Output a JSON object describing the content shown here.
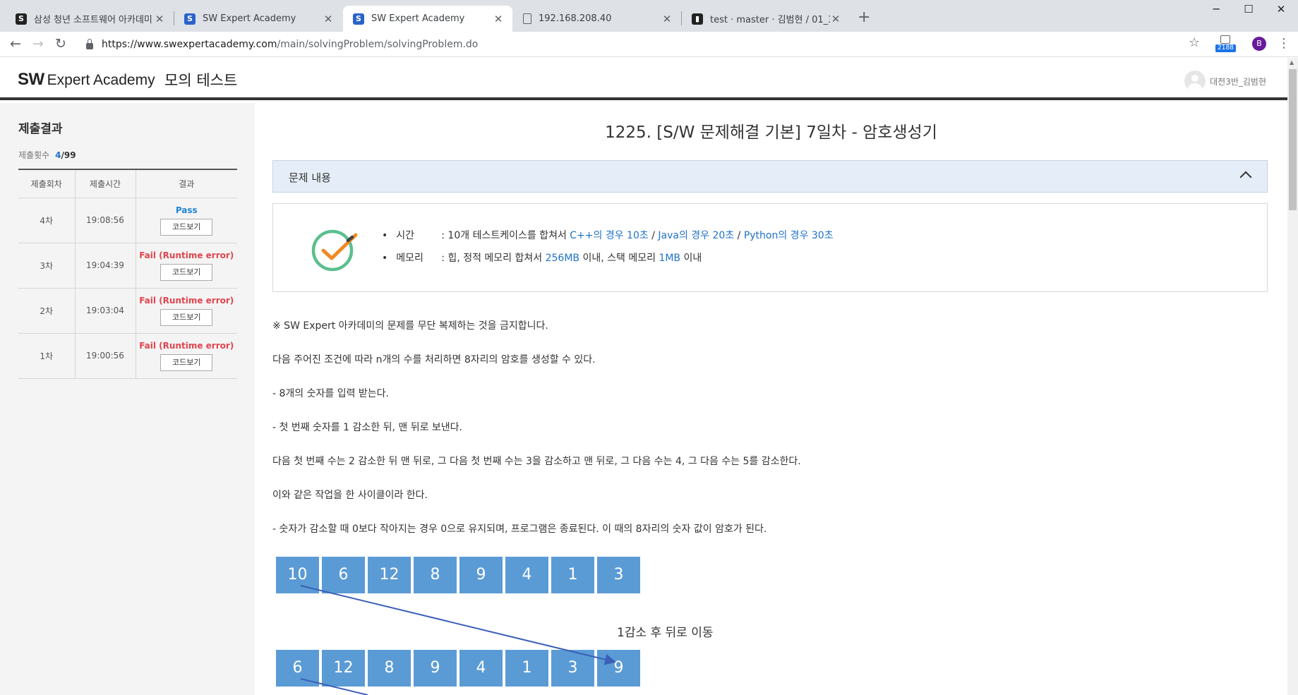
{
  "browser": {
    "tabs": [
      {
        "title": "삼성 청년 소프트웨어 아카데미",
        "favicon": "ssafy-icon"
      },
      {
        "title": "SW Expert Academy",
        "favicon": "swea-icon"
      },
      {
        "title": "SW Expert Academy",
        "favicon": "swea-icon"
      },
      {
        "title": "192.168.208.40",
        "favicon": "document-icon"
      },
      {
        "title": "test · master · 김범현 / 01_3_ho",
        "favicon": "gitlab-icon"
      }
    ],
    "url_host": "https://www.swexpertacademy.com",
    "url_path": "/main/solvingProblem/solvingProblem.do",
    "extension_badge": "2188",
    "profile_initial": "B"
  },
  "header": {
    "logo_bold": "SW",
    "logo_text": "Expert Academy",
    "section": "모의 테스트",
    "user_name": "대전3반_김범현"
  },
  "submissions": {
    "title": "제출결과",
    "count_label": "제출횟수",
    "count_now": "4",
    "count_total": "/99",
    "columns": [
      "제출회차",
      "제출시간",
      "결과"
    ],
    "code_button": "코드보기",
    "rows": [
      {
        "round": "4차",
        "time": "19:08:56",
        "result": "Pass",
        "status": "pass"
      },
      {
        "round": "3차",
        "time": "19:04:39",
        "result": "Fail (Runtime error)",
        "status": "fail"
      },
      {
        "round": "2차",
        "time": "19:03:04",
        "result": "Fail (Runtime error)",
        "status": "fail"
      },
      {
        "round": "1차",
        "time": "19:00:56",
        "result": "Fail (Runtime error)",
        "status": "fail"
      }
    ]
  },
  "problem": {
    "title": "1225. [S/W 문제해결 기본] 7일차 - 암호생성기",
    "section_label": "문제 내용",
    "time_label": "시간",
    "time_prefix": ": 10개 테스트케이스를 합쳐서",
    "time_cpp": "C++의 경우 10초",
    "time_java": "Java의 경우 20초",
    "time_python": "Python의 경우 30초",
    "memory_label": "메모리",
    "memory_prefix": ": 힙, 정적 메모리 합쳐서",
    "memory_heap": "256MB",
    "memory_mid": "이내, 스택 메모리",
    "memory_stack": "1MB",
    "memory_suffix": "이내",
    "paragraphs": [
      "※ SW Expert 아카데미의 문제를 무단 복제하는 것을 금지합니다.",
      "다음 주어진 조건에 따라 n개의 수를 처리하면 8자리의 암호를 생성할 수 있다.",
      "- 8개의 숫자를 입력 받는다.",
      "- 첫 번째 숫자를 1 감소한 뒤, 맨 뒤로 보낸다.",
      "다음 첫 번째 수는 2 감소한 뒤 맨 뒤로, 그 다음 첫 번째 수는 3을 감소하고 맨 뒤로, 그 다음 수는 4, 그 다음 수는 5를 감소한다.",
      "이와 같은 작업을 한 사이클이라 한다.",
      "- 숫자가 감소할 때 0보다 작아지는 경우 0으로 유지되며, 프로그램은 종료된다. 이 때의 8자리의 숫자 값이 암호가 된다."
    ],
    "row1": [
      "10",
      "6",
      "12",
      "8",
      "9",
      "4",
      "1",
      "3"
    ],
    "row2": [
      "6",
      "12",
      "8",
      "9",
      "4",
      "1",
      "3",
      "9"
    ],
    "caption": "1감소 후 뒤로 이동"
  }
}
